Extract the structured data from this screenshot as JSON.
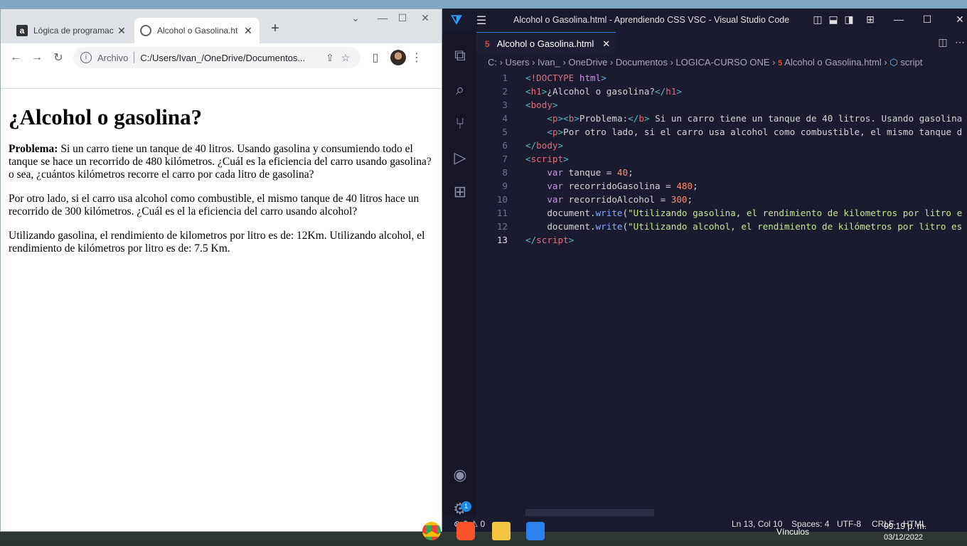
{
  "chrome": {
    "tabs": [
      {
        "title": "Lógica de programac",
        "close": "✕"
      },
      {
        "title": "Alcohol o Gasolina.ht",
        "close": "✕"
      }
    ],
    "new_tab": "+",
    "address": {
      "scheme": "Archivo",
      "url": "C:/Users/Ivan_/OneDrive/Documentos..."
    },
    "page": {
      "heading": "¿Alcohol o gasolina?",
      "p1_bold": "Problema:",
      "p1": " Si un carro tiene un tanque de 40 litros. Usando gasolina y consumiendo todo el tanque se hace un recorrido de 480 kilómetros. ¿Cuál es la eficiencia del carro usando gasolina? o sea, ¿cuántos kilómetros recorre el carro por cada litro de gasolina?",
      "p2": "Por otro lado, si el carro usa alcohol como combustible, el mismo tanque de 40 litros hace un recorrido de 300 kilómetros. ¿Cuál es el la eficiencia del carro usando alcohol?",
      "output": "Utilizando gasolina, el rendimiento de kilometros por litro es de: 12Km. Utilizando alcohol, el rendimiento de kilómetros por litro es de: 7.5 Km."
    }
  },
  "vscode": {
    "title": "Alcohol o Gasolina.html - Aprendiendo CSS VSC - Visual Studio Code",
    "tab": "Alcohol o Gasolina.html",
    "breadcrumb": {
      "path": "C: › Users › Ivan_ › OneDrive › Documentos › LOGICA-CURSO ONE ›",
      "file": "Alcohol o Gasolina.html",
      "symbol": "script"
    },
    "line_numbers": [
      "1",
      "2",
      "3",
      "4",
      "5",
      "6",
      "7",
      "8",
      "9",
      "10",
      "11",
      "12",
      "13"
    ],
    "status": {
      "problems": "⊗ 0 ⚠ 0",
      "position": "Ln 13, Col 10",
      "spaces": "Spaces: 4",
      "encoding": "UTF-8",
      "eol": "CRLF",
      "language": "HTML"
    },
    "settings_badge": "1"
  },
  "taskbar": {
    "links": "Vínculos",
    "time": "09:19 p. m.",
    "date": "03/12/2022"
  },
  "colors": {
    "vscode_accent": "#2f80ed",
    "html_icon": "#e44d26"
  }
}
